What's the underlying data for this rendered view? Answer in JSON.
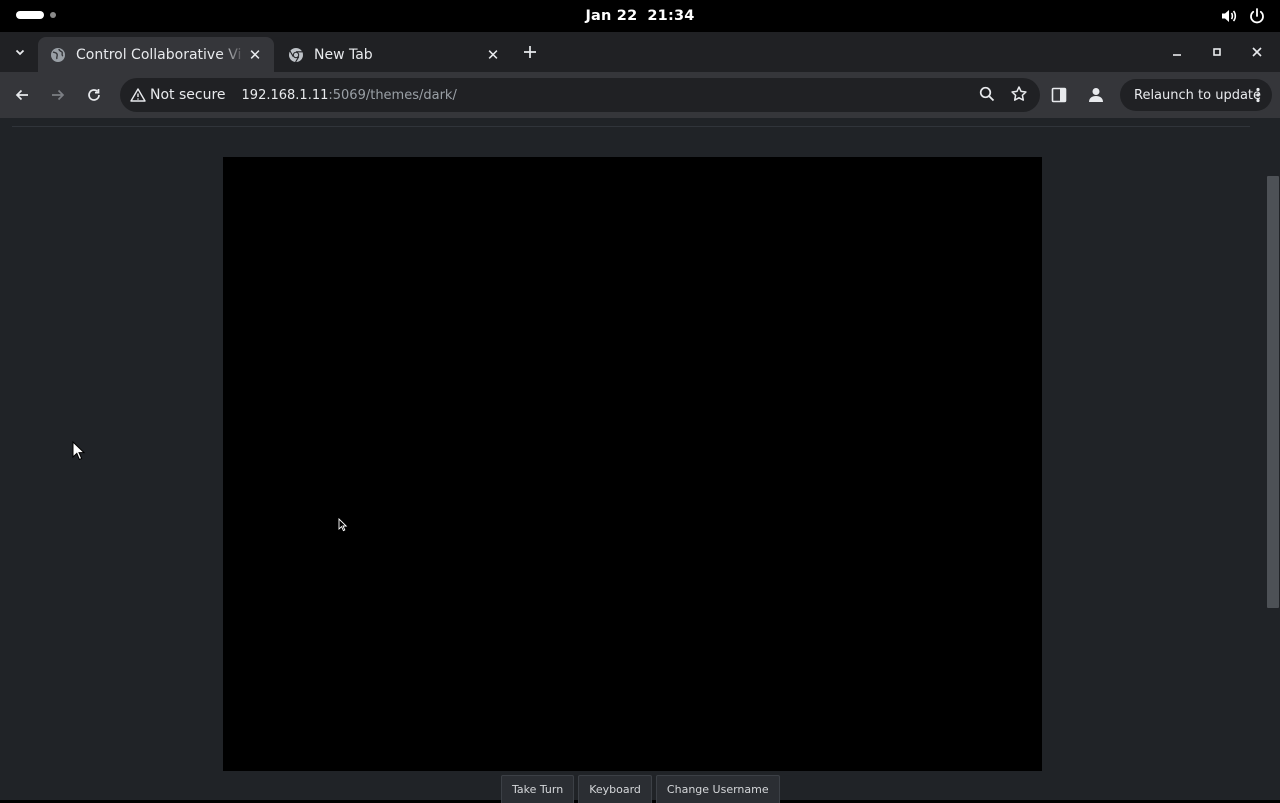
{
  "system_bar": {
    "date": "Jan 22",
    "time": "21:34",
    "icons": [
      "activities-pill",
      "volume-icon",
      "power-icon"
    ]
  },
  "tabs": [
    {
      "title": "Control Collaborative Vi",
      "icon": "globe-icon",
      "active": true
    },
    {
      "title": "New Tab",
      "icon": "chrome-icon",
      "active": false
    }
  ],
  "toolbar": {
    "security_label": "Not secure",
    "url_host": "192.168.1.11",
    "url_rest": ":5069/themes/dark/",
    "relaunch_label": "Relaunch to update"
  },
  "page": {
    "buttons": {
      "take_turn": "Take Turn",
      "keyboard": "Keyboard",
      "change_username": "Change Username"
    }
  },
  "colors": {
    "page_background": "#202327",
    "viewer_background": "#000000",
    "toolbar": "#35363a",
    "tabstrip": "#202124"
  }
}
